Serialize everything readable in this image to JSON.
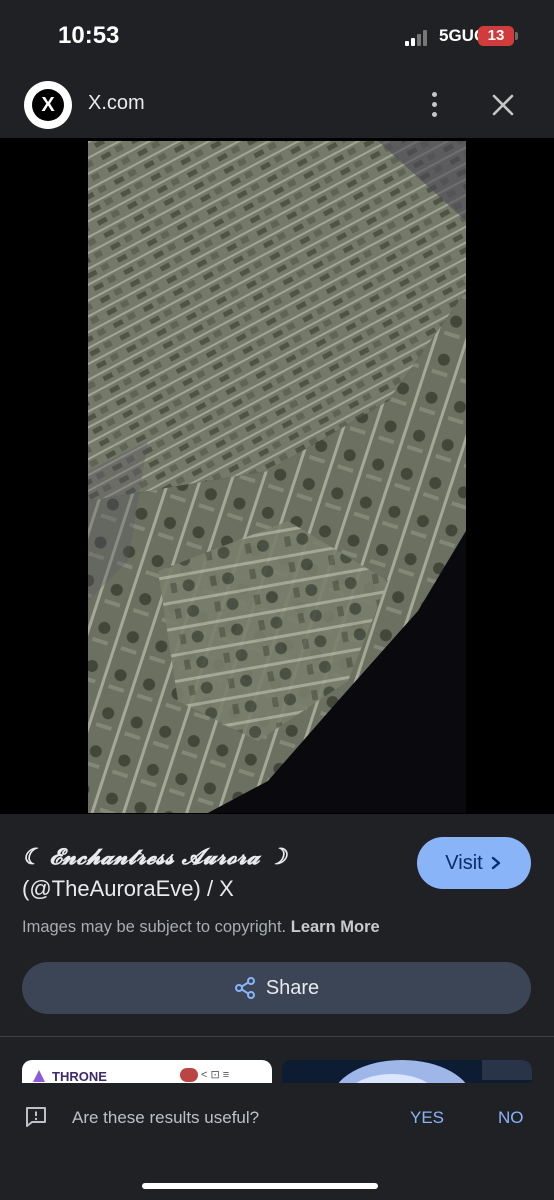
{
  "status_bar": {
    "time": "10:53",
    "network": "5GUC",
    "battery": "13",
    "battery_color": "#d13b3b"
  },
  "header": {
    "site_name": "X.com",
    "logo_letter": "X",
    "menu_icon": "more-vert-icon",
    "close_icon": "close-icon"
  },
  "result": {
    "title_line1": "☾ 𝓔𝓷𝓬𝓱𝓪𝓷𝓽𝓻𝓮𝓼𝓼 𝓐𝓾𝓻𝓸𝓻𝓪 ☽",
    "title_line2": "(@TheAuroraEve) / X",
    "visit_label": "Visit",
    "copyright_text": "Images may be subject to copyright.",
    "learn_more": "Learn More",
    "share_label": "Share",
    "accent": "#8ab4f8"
  },
  "related": {
    "thumb1_name": "THRONE"
  },
  "feedback": {
    "question": "Are these results useful?",
    "yes": "YES",
    "no": "NO"
  }
}
